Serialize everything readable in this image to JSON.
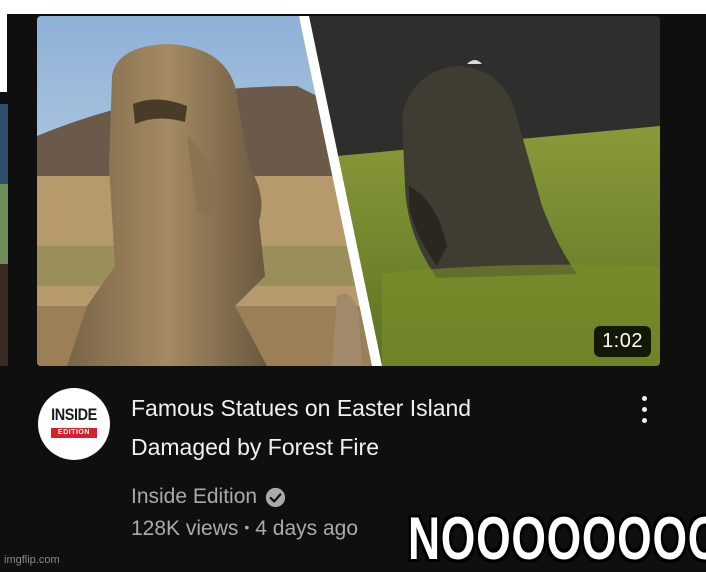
{
  "video": {
    "duration": "1:02",
    "title_line1": "Famous Statues on Easter Island",
    "title_line2": "Damaged by Forest Fire",
    "thumbnail_alt": "Moai statue before and after fire"
  },
  "channel": {
    "name": "Inside Edition",
    "logo_top": "INSIDE",
    "logo_bottom": "EDITION",
    "verified": true
  },
  "stats": {
    "views": "128K views",
    "separator": "•",
    "age": "4 days ago"
  },
  "meme": {
    "caption": "NOOOOOOOO",
    "watermark": "imgflip.com"
  },
  "colors": {
    "background": "#0f0f0f",
    "title": "#f1f1f1",
    "secondary": "#aaaaaa",
    "brand_red": "#d6202b"
  },
  "icons": {
    "menu": "more-vert-icon",
    "verified": "verified-check-icon"
  }
}
